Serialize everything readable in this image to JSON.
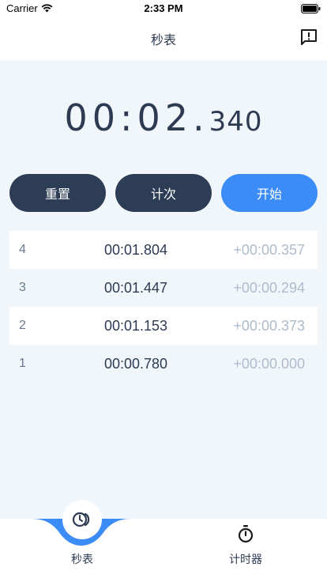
{
  "status_bar": {
    "carrier": "Carrier",
    "time": "2:33 PM"
  },
  "nav": {
    "title": "秒表",
    "feedback_icon": "feedback-icon"
  },
  "stopwatch": {
    "time_main": "00:02.",
    "time_ms": "340"
  },
  "buttons": {
    "reset": "重置",
    "lap": "计次",
    "start": "开始"
  },
  "laps": [
    {
      "index": "4",
      "time": "00:01.804",
      "diff": "+00:00.357"
    },
    {
      "index": "3",
      "time": "00:01.447",
      "diff": "+00:00.294"
    },
    {
      "index": "2",
      "time": "00:01.153",
      "diff": "+00:00.373"
    },
    {
      "index": "1",
      "time": "00:00.780",
      "diff": "+00:00.000"
    }
  ],
  "tabs": [
    {
      "label": "秒表",
      "icon": "stopwatch-icon",
      "active": true
    },
    {
      "label": "计时器",
      "icon": "timer-icon",
      "active": false
    }
  ],
  "colors": {
    "accent": "#3b8cf6",
    "dark_button": "#2e3d56",
    "background": "#f1f6fa"
  }
}
